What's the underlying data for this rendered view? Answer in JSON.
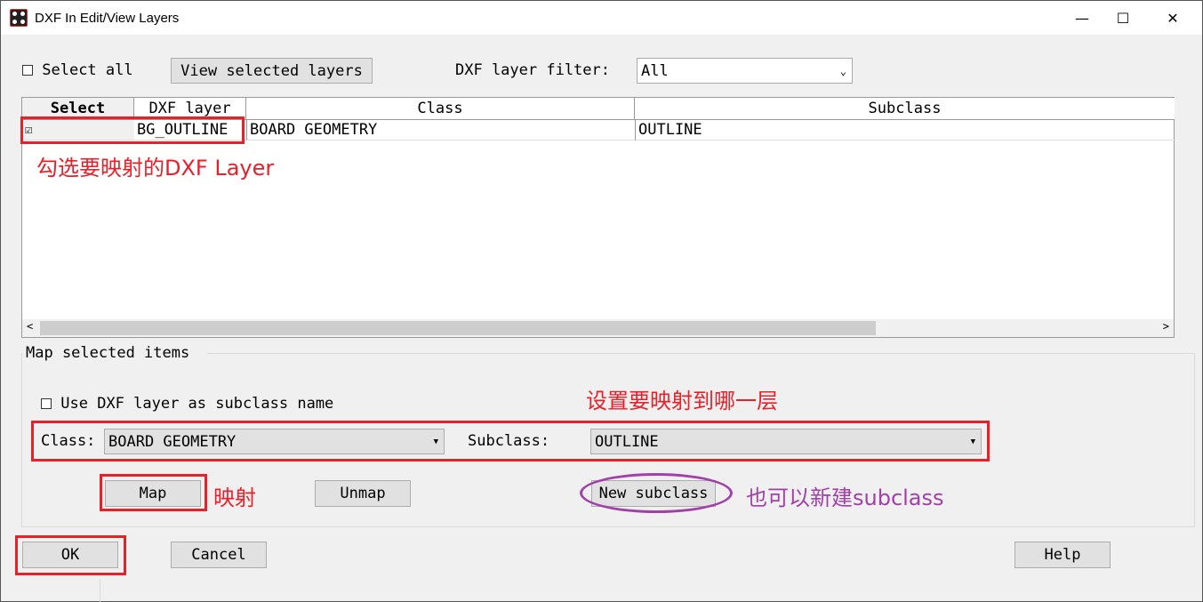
{
  "window": {
    "title": "DXF In Edit/View Layers",
    "minimize": "—",
    "maximize": "☐",
    "close": "✕"
  },
  "toolbar": {
    "select_all": "Select all",
    "view_selected": "View selected layers",
    "filter_label": "DXF layer filter:",
    "filter_value": "All"
  },
  "table": {
    "columns": [
      "Select",
      "DXF layer",
      "Class",
      "Subclass"
    ],
    "rows": [
      {
        "checked": true,
        "check_glyph": "☑",
        "layer": "BG_OUTLINE",
        "class": "BOARD GEOMETRY",
        "subclass": "OUTLINE"
      }
    ]
  },
  "map": {
    "group_title": "Map selected items",
    "use_dxf": "Use DXF layer as subclass name",
    "class_label": "Class:",
    "class_value": "BOARD GEOMETRY",
    "subclass_label": "Subclass:",
    "subclass_value": "OUTLINE",
    "map": "Map",
    "unmap": "Unmap",
    "new_subclass": "New subclass"
  },
  "footer": {
    "ok": "OK",
    "cancel": "Cancel",
    "help": "Help"
  },
  "annotations": {
    "select_layer": "勾选要映射的DXF Layer",
    "set_layer": "设置要映射到哪一层",
    "map": "映射",
    "new": "也可以新建subclass",
    "red": "#e8202a",
    "purple": "#a040a8"
  }
}
